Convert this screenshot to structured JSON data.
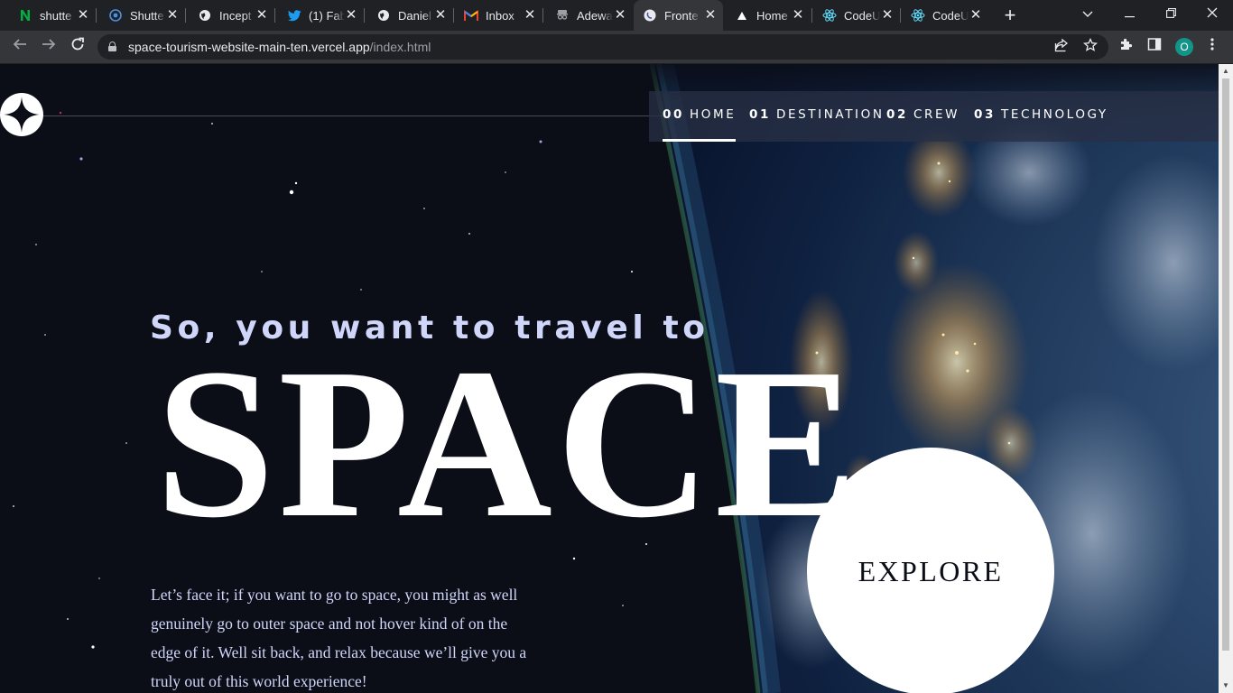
{
  "browser": {
    "tabs": [
      {
        "title": "shutte",
        "icon": "green-n-favicon-icon",
        "active": false
      },
      {
        "title": "Shutte",
        "icon": "blue-globe-favicon-icon",
        "active": false
      },
      {
        "title": "Incept",
        "icon": "globe-icon",
        "active": false
      },
      {
        "title": "(1) Fab",
        "icon": "twitter-bird-icon",
        "active": false
      },
      {
        "title": "Daniel",
        "icon": "globe-icon",
        "active": false
      },
      {
        "title": "Inbox",
        "icon": "gmail-icon",
        "active": false
      },
      {
        "title": "Adewa",
        "icon": "incognito-avatar-icon",
        "active": false
      },
      {
        "title": "Fronte",
        "icon": "frontend-mentor-icon",
        "active": true
      },
      {
        "title": "Home",
        "icon": "triangle-icon",
        "active": false
      },
      {
        "title": "CodeU",
        "icon": "react-icon",
        "active": false
      },
      {
        "title": "CodeU",
        "icon": "react-icon",
        "active": false
      }
    ],
    "url_host": "space-tourism-website-main-ten.vercel.app",
    "url_path": "/index.html",
    "profile_initial": "O"
  },
  "nav": {
    "items": [
      {
        "number": "00",
        "label": "HOME",
        "current": true
      },
      {
        "number": "01",
        "label": "DESTINATION",
        "current": false
      },
      {
        "number": "02",
        "label": "CREW",
        "current": false
      },
      {
        "number": "03",
        "label": "TECHNOLOGY",
        "current": false
      }
    ]
  },
  "hero": {
    "eyebrow": "So, you want to travel to",
    "title": "SPACE",
    "text": "Let’s face it; if you want to go to space, you might as well genuinely go to outer space and not hover kind of on the edge of it. Well sit back, and relax because we’ll give you a truly out of this world experience!"
  },
  "explore_button": {
    "label": "EXPLORE"
  },
  "colors": {
    "page_bg": "#0b0d17",
    "accent_lavender": "#d0d6f9",
    "white": "#ffffff",
    "chrome_dark": "#202124",
    "chrome_mid": "#35363a"
  }
}
